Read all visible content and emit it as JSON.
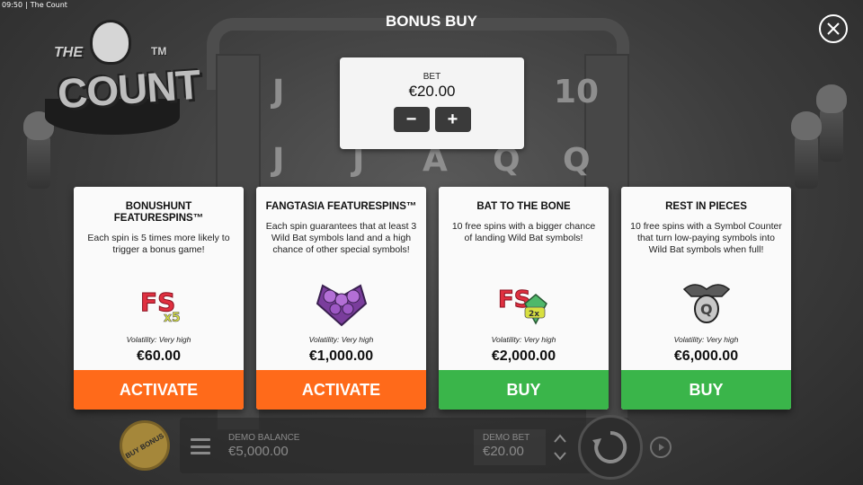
{
  "status_bar": {
    "time": "09:50",
    "app_name": "The Count"
  },
  "logo": {
    "the": "THE",
    "count": "COUNT",
    "tm": "TM"
  },
  "title": "BONUS BUY",
  "bet": {
    "label": "BET",
    "value": "€20.00",
    "minus": "−",
    "plus": "+"
  },
  "cards": [
    {
      "title": "BONUSHUNT FEATURESPINS™",
      "description": "Each spin is 5 times more likely to trigger a bonus game!",
      "icon": "fs-x5-icon",
      "volatility": "Volatility: Very high",
      "price": "€60.00",
      "button": "ACTIVATE",
      "button_color": "#ff6a1a"
    },
    {
      "title": "FANGTASIA FEATURESPINS™",
      "description": "Each spin guarantees that at least 3 Wild Bat symbols land and a high chance of other special symbols!",
      "icon": "wild-bats-icon",
      "volatility": "Volatility: Very high",
      "price": "€1,000.00",
      "button": "ACTIVATE",
      "button_color": "#ff6a1a"
    },
    {
      "title": "BAT TO THE BONE",
      "description": "10 free spins with a bigger chance of landing Wild Bat symbols!",
      "icon": "fs-2x-bat-icon",
      "volatility": "Volatility: Very high",
      "price": "€2,000.00",
      "button": "BUY",
      "button_color": "#3ab54a"
    },
    {
      "title": "REST IN PIECES",
      "description": "10 free spins with a Symbol Counter that turn low-paying symbols into Wild Bat symbols when full!",
      "icon": "bat-q-symbol-icon",
      "volatility": "Volatility: Very high",
      "price": "€6,000.00",
      "button": "BUY",
      "button_color": "#3ab54a"
    }
  ],
  "bottom": {
    "buy_bonus": "BUY BONUS",
    "balance_label": "DEMO BALANCE",
    "balance_value": "€5,000.00",
    "bet_label": "DEMO BET",
    "bet_value": "€20.00"
  },
  "reel_symbols": [
    "J",
    "10",
    "J",
    "J",
    "A",
    "Q",
    "Q"
  ]
}
